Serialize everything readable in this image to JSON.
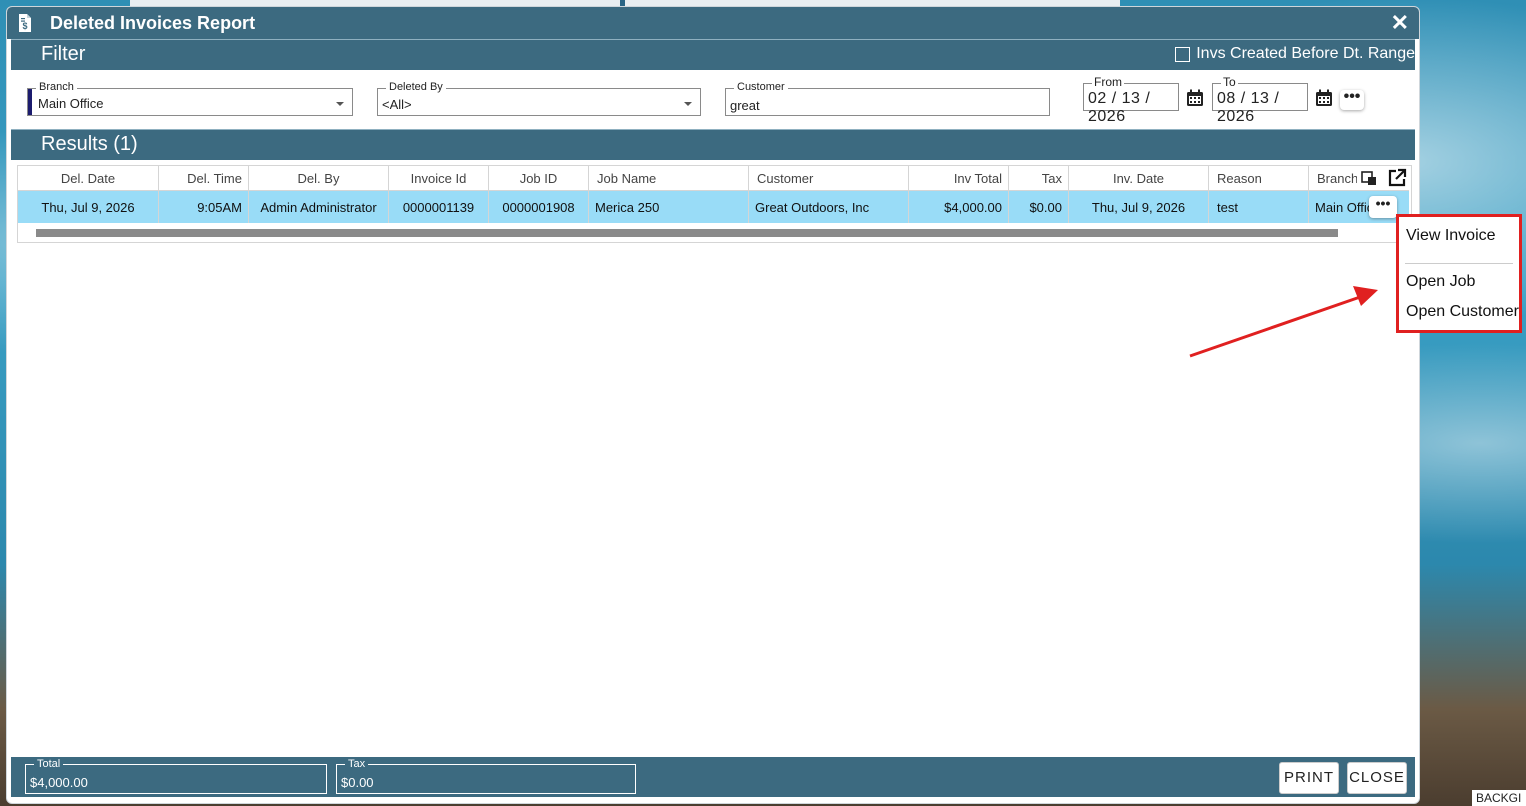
{
  "window": {
    "title": "Deleted Invoices Report",
    "close_label": "✕"
  },
  "filter": {
    "heading": "Filter",
    "invs_before_range_label": "Invs Created Before Dt. Range",
    "invs_before_range_checked": false,
    "branch": {
      "label": "Branch",
      "value": "Main Office"
    },
    "deleted_by": {
      "label": "Deleted By",
      "value": "<All>"
    },
    "customer": {
      "label": "Customer",
      "value": "great"
    },
    "from": {
      "label": "From",
      "value": "02 / 13 / 2026"
    },
    "to": {
      "label": "To",
      "value": "08 / 13 / 2026"
    },
    "more_label": "•••"
  },
  "results": {
    "heading": "Results (1)",
    "columns": [
      "Del. Date",
      "Del. Time",
      "Del. By",
      "Invoice Id",
      "Job ID",
      "Job Name",
      "Customer",
      "Inv Total",
      "Tax",
      "Inv. Date",
      "Reason",
      "Branch"
    ],
    "rows": [
      [
        "Thu, Jul 9, 2026",
        "9:05AM",
        "Admin Administrator",
        "0000001139",
        "0000001908",
        "Merica 250",
        "Great Outdoors, Inc",
        "$4,000.00",
        "$0.00",
        "Thu, Jul 9, 2026",
        "test",
        "Main Office"
      ]
    ],
    "row_more_label": "•••"
  },
  "context_menu": {
    "items": [
      "View Invoice",
      "Open Job",
      "Open Customer"
    ]
  },
  "footer": {
    "total": {
      "label": "Total",
      "value": "$4,000.00"
    },
    "tax": {
      "label": "Tax",
      "value": "$0.00"
    },
    "print_label": "PRINT",
    "close_label": "CLOSE"
  },
  "background": {
    "corner_label": "BACKGI"
  },
  "colors": {
    "header": "#3c6a80",
    "selected_row": "#99dcf7",
    "annotation": "#e02020"
  }
}
